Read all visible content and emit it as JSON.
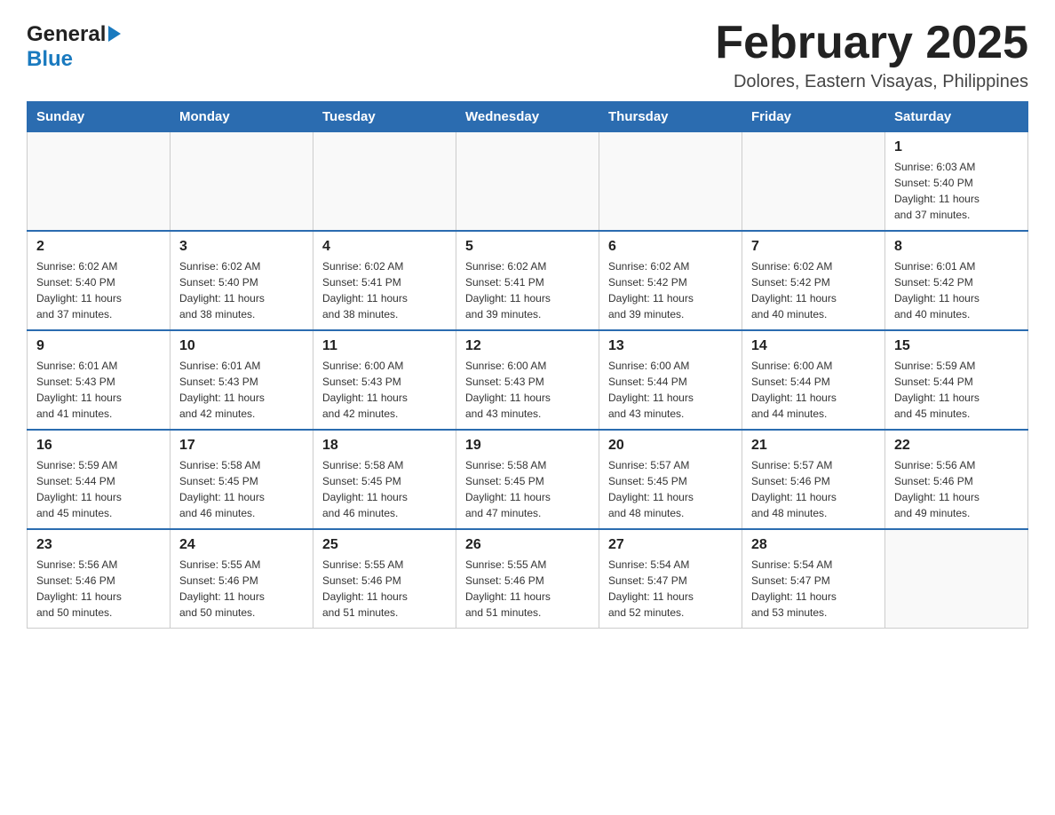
{
  "logo": {
    "general": "General",
    "blue": "Blue"
  },
  "title": "February 2025",
  "subtitle": "Dolores, Eastern Visayas, Philippines",
  "days_of_week": [
    "Sunday",
    "Monday",
    "Tuesday",
    "Wednesday",
    "Thursday",
    "Friday",
    "Saturday"
  ],
  "weeks": [
    [
      {
        "day": "",
        "info": ""
      },
      {
        "day": "",
        "info": ""
      },
      {
        "day": "",
        "info": ""
      },
      {
        "day": "",
        "info": ""
      },
      {
        "day": "",
        "info": ""
      },
      {
        "day": "",
        "info": ""
      },
      {
        "day": "1",
        "info": "Sunrise: 6:03 AM\nSunset: 5:40 PM\nDaylight: 11 hours\nand 37 minutes."
      }
    ],
    [
      {
        "day": "2",
        "info": "Sunrise: 6:02 AM\nSunset: 5:40 PM\nDaylight: 11 hours\nand 37 minutes."
      },
      {
        "day": "3",
        "info": "Sunrise: 6:02 AM\nSunset: 5:40 PM\nDaylight: 11 hours\nand 38 minutes."
      },
      {
        "day": "4",
        "info": "Sunrise: 6:02 AM\nSunset: 5:41 PM\nDaylight: 11 hours\nand 38 minutes."
      },
      {
        "day": "5",
        "info": "Sunrise: 6:02 AM\nSunset: 5:41 PM\nDaylight: 11 hours\nand 39 minutes."
      },
      {
        "day": "6",
        "info": "Sunrise: 6:02 AM\nSunset: 5:42 PM\nDaylight: 11 hours\nand 39 minutes."
      },
      {
        "day": "7",
        "info": "Sunrise: 6:02 AM\nSunset: 5:42 PM\nDaylight: 11 hours\nand 40 minutes."
      },
      {
        "day": "8",
        "info": "Sunrise: 6:01 AM\nSunset: 5:42 PM\nDaylight: 11 hours\nand 40 minutes."
      }
    ],
    [
      {
        "day": "9",
        "info": "Sunrise: 6:01 AM\nSunset: 5:43 PM\nDaylight: 11 hours\nand 41 minutes."
      },
      {
        "day": "10",
        "info": "Sunrise: 6:01 AM\nSunset: 5:43 PM\nDaylight: 11 hours\nand 42 minutes."
      },
      {
        "day": "11",
        "info": "Sunrise: 6:00 AM\nSunset: 5:43 PM\nDaylight: 11 hours\nand 42 minutes."
      },
      {
        "day": "12",
        "info": "Sunrise: 6:00 AM\nSunset: 5:43 PM\nDaylight: 11 hours\nand 43 minutes."
      },
      {
        "day": "13",
        "info": "Sunrise: 6:00 AM\nSunset: 5:44 PM\nDaylight: 11 hours\nand 43 minutes."
      },
      {
        "day": "14",
        "info": "Sunrise: 6:00 AM\nSunset: 5:44 PM\nDaylight: 11 hours\nand 44 minutes."
      },
      {
        "day": "15",
        "info": "Sunrise: 5:59 AM\nSunset: 5:44 PM\nDaylight: 11 hours\nand 45 minutes."
      }
    ],
    [
      {
        "day": "16",
        "info": "Sunrise: 5:59 AM\nSunset: 5:44 PM\nDaylight: 11 hours\nand 45 minutes."
      },
      {
        "day": "17",
        "info": "Sunrise: 5:58 AM\nSunset: 5:45 PM\nDaylight: 11 hours\nand 46 minutes."
      },
      {
        "day": "18",
        "info": "Sunrise: 5:58 AM\nSunset: 5:45 PM\nDaylight: 11 hours\nand 46 minutes."
      },
      {
        "day": "19",
        "info": "Sunrise: 5:58 AM\nSunset: 5:45 PM\nDaylight: 11 hours\nand 47 minutes."
      },
      {
        "day": "20",
        "info": "Sunrise: 5:57 AM\nSunset: 5:45 PM\nDaylight: 11 hours\nand 48 minutes."
      },
      {
        "day": "21",
        "info": "Sunrise: 5:57 AM\nSunset: 5:46 PM\nDaylight: 11 hours\nand 48 minutes."
      },
      {
        "day": "22",
        "info": "Sunrise: 5:56 AM\nSunset: 5:46 PM\nDaylight: 11 hours\nand 49 minutes."
      }
    ],
    [
      {
        "day": "23",
        "info": "Sunrise: 5:56 AM\nSunset: 5:46 PM\nDaylight: 11 hours\nand 50 minutes."
      },
      {
        "day": "24",
        "info": "Sunrise: 5:55 AM\nSunset: 5:46 PM\nDaylight: 11 hours\nand 50 minutes."
      },
      {
        "day": "25",
        "info": "Sunrise: 5:55 AM\nSunset: 5:46 PM\nDaylight: 11 hours\nand 51 minutes."
      },
      {
        "day": "26",
        "info": "Sunrise: 5:55 AM\nSunset: 5:46 PM\nDaylight: 11 hours\nand 51 minutes."
      },
      {
        "day": "27",
        "info": "Sunrise: 5:54 AM\nSunset: 5:47 PM\nDaylight: 11 hours\nand 52 minutes."
      },
      {
        "day": "28",
        "info": "Sunrise: 5:54 AM\nSunset: 5:47 PM\nDaylight: 11 hours\nand 53 minutes."
      },
      {
        "day": "",
        "info": ""
      }
    ]
  ],
  "colors": {
    "header_bg": "#2b6cb0",
    "header_text": "#ffffff",
    "border": "#cccccc",
    "accent_blue": "#1a7abf"
  }
}
